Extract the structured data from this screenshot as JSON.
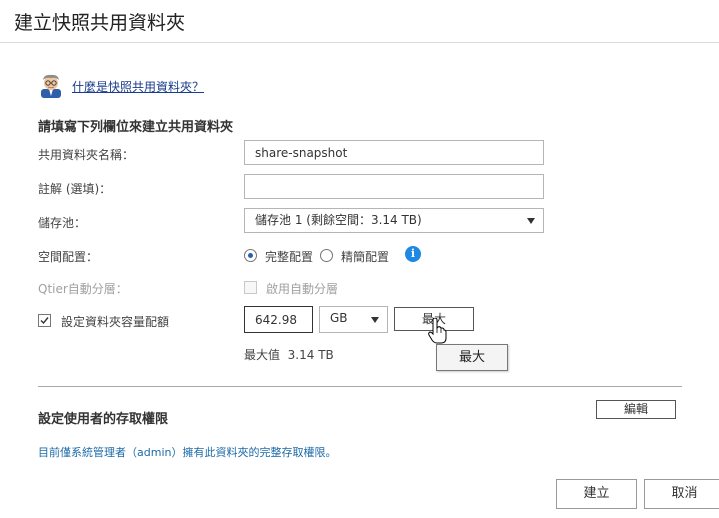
{
  "dialog": {
    "title": "建立快照共用資料夾"
  },
  "help": {
    "link_text": "什麼是快照共用資料夾？"
  },
  "form": {
    "heading": "請填寫下列欄位來建立共用資料夾",
    "share_name": {
      "label": "共用資料夾名稱：",
      "value": "share-snapshot"
    },
    "comment": {
      "label": "註解 (選填)：",
      "value": ""
    },
    "storage_pool": {
      "label": "儲存池：",
      "selected": "儲存池 1 (剩餘空間：3.14 TB)"
    },
    "space_allocation": {
      "label": "空間配置：",
      "options": [
        "完整配置",
        "精簡配置"
      ],
      "selected": "完整配置",
      "info_icon": "i"
    },
    "qtier": {
      "label": "Qtier自動分層：",
      "checkbox_label": "啟用自動分層",
      "checked": false,
      "enabled": false
    },
    "quota": {
      "checkbox_label": "設定資料夾容量配額",
      "checked": true,
      "value": "642.98",
      "unit": "GB",
      "max_button": "最大",
      "tooltip": "最大",
      "max_value_label": "最大值",
      "max_value": "3.14 TB"
    }
  },
  "permissions": {
    "heading": "設定使用者的存取權限",
    "edit_button": "編輯",
    "note": "目前僅系統管理者（admin）擁有此資料夾的完整存取權限。"
  },
  "footer": {
    "create_button": "建立",
    "cancel_button": "取消"
  },
  "colors": {
    "accent": "#1e88e5",
    "link": "#1a3c8c",
    "note_text": "#1c6aa7"
  }
}
